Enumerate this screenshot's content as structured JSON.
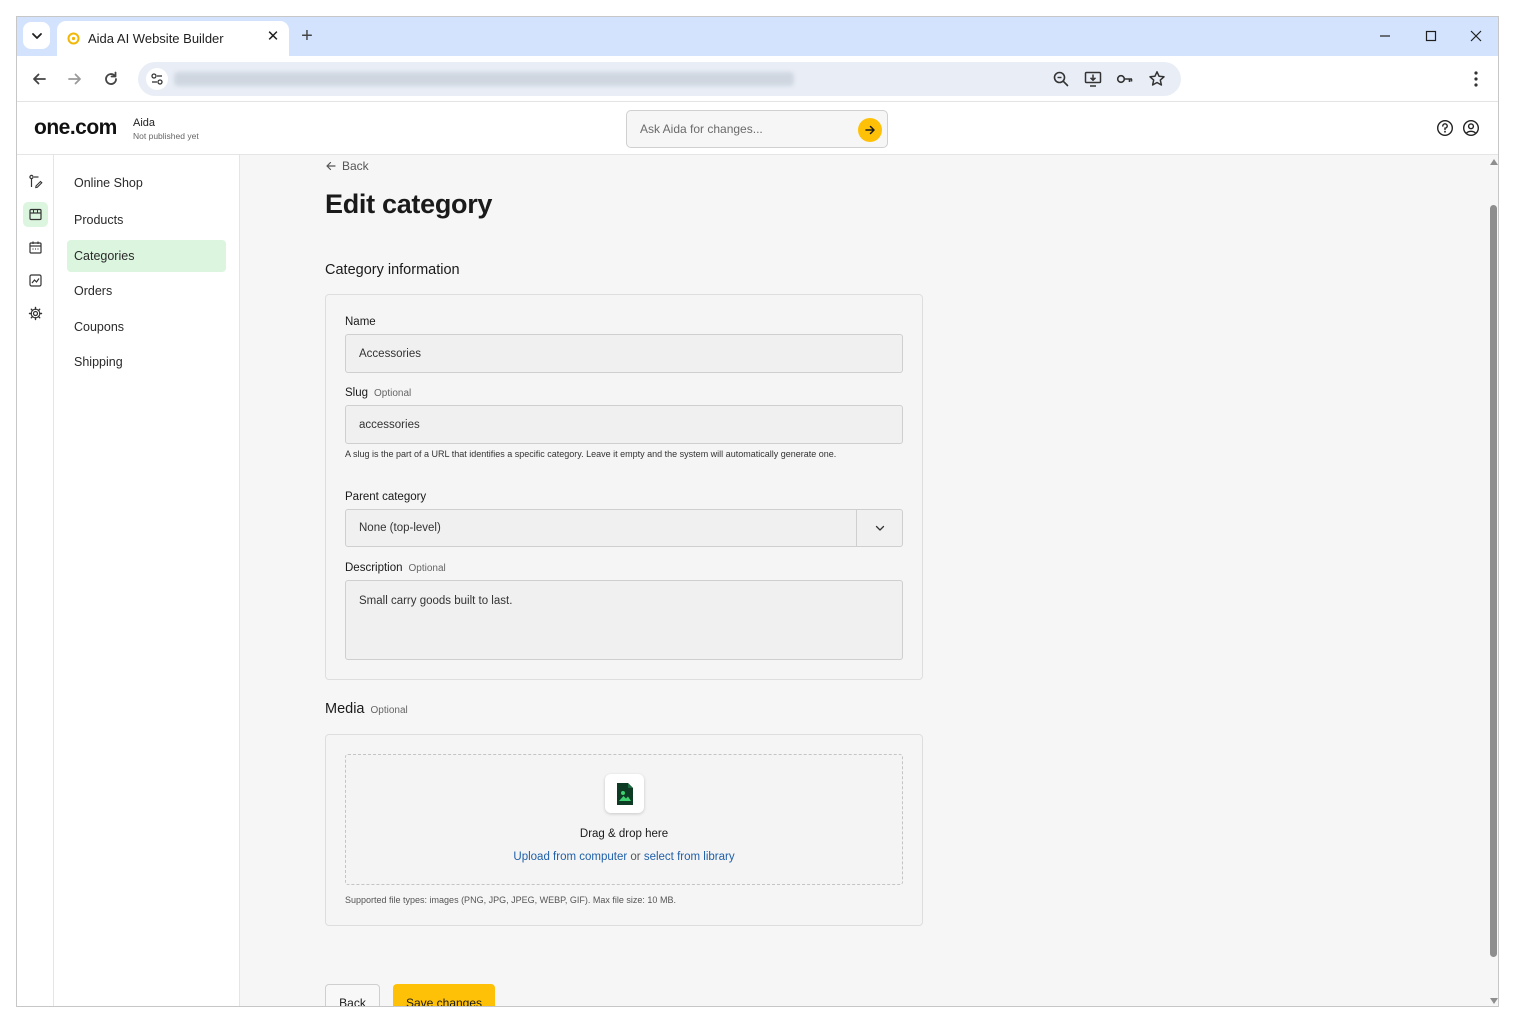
{
  "browser": {
    "tab_title": "Aida AI Website Builder",
    "close_glyph": "✕",
    "new_tab_glyph": "+"
  },
  "app": {
    "logo": "one.com",
    "site_name": "Aida",
    "site_status": "Not published yet",
    "ask_placeholder": "Ask Aida for changes...",
    "accent_color": "#ffc107",
    "active_nav_color": "#dcf5df"
  },
  "sidenav": {
    "items": [
      {
        "label": "Online Shop"
      },
      {
        "label": "Products"
      },
      {
        "label": "Categories",
        "active": true
      },
      {
        "label": "Orders"
      },
      {
        "label": "Coupons"
      },
      {
        "label": "Shipping"
      }
    ]
  },
  "page": {
    "back_label": "Back",
    "title": "Edit category",
    "category_section_title": "Category information",
    "name": {
      "label": "Name",
      "value": "Accessories"
    },
    "slug": {
      "label": "Slug",
      "optional": "Optional",
      "value": "accessories",
      "hint": "A slug is the part of a URL that identifies a specific category. Leave it empty and the system will automatically generate one."
    },
    "parent": {
      "label": "Parent category",
      "value": "None (top-level)"
    },
    "description": {
      "label": "Description",
      "optional": "Optional",
      "value": "Small carry goods built to last."
    },
    "media": {
      "title": "Media",
      "optional": "Optional",
      "drop_title": "Drag & drop here",
      "upload_link": "Upload from computer",
      "or": "or",
      "library_link": "select from library",
      "note": "Supported file types: images (PNG, JPG, JPEG, WEBP, GIF). Max file size: 10 MB."
    },
    "buttons": {
      "back": "Back",
      "save": "Save changes"
    }
  }
}
